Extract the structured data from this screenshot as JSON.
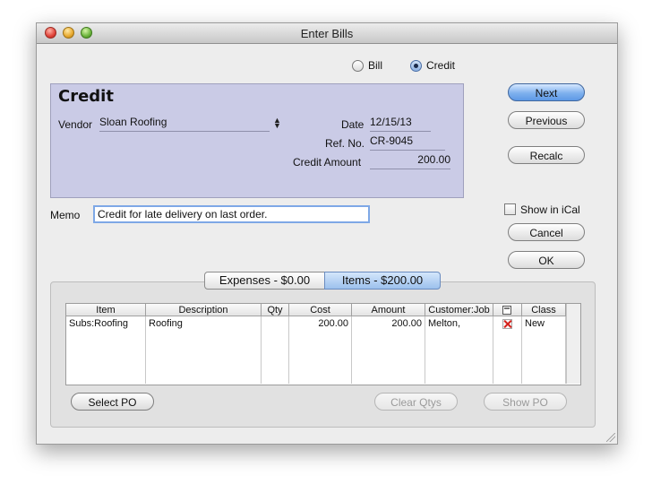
{
  "window": {
    "title": "Enter Bills"
  },
  "mode": {
    "bill_label": "Bill",
    "credit_label": "Credit",
    "selected": "credit"
  },
  "form": {
    "heading": "Credit",
    "vendor_label": "Vendor",
    "vendor_value": "Sloan Roofing",
    "date_label": "Date",
    "date_value": "12/15/13",
    "ref_label": "Ref. No.",
    "ref_value": "CR-9045",
    "amount_label": "Credit Amount",
    "amount_value": "200.00"
  },
  "memo": {
    "label": "Memo",
    "value": "Credit for late delivery on last order."
  },
  "buttons": {
    "next": "Next",
    "previous": "Previous",
    "recalc": "Recalc",
    "cancel": "Cancel",
    "ok": "OK",
    "select_po": "Select PO",
    "clear_qtys": "Clear Qtys",
    "show_po": "Show PO"
  },
  "show_in_ical": {
    "label": "Show in iCal",
    "checked": false
  },
  "tabs": [
    {
      "label": "Expenses - $0.00",
      "selected": false
    },
    {
      "label": "Items - $200.00",
      "selected": true
    }
  ],
  "table": {
    "columns": [
      "Item",
      "Description",
      "Qty",
      "Cost",
      "Amount",
      "Customer:Job",
      "",
      "Class"
    ],
    "rows": [
      {
        "item": "Subs:Roofing",
        "description": "Roofing",
        "qty": "",
        "cost": "200.00",
        "amount": "200.00",
        "customer_job": "Melton,",
        "billable": "x-mark",
        "class": "New"
      }
    ]
  },
  "colors": {
    "panel": "#cacbe6",
    "default_button": "#7fb1ee",
    "focus_ring": "#7ea8e6"
  },
  "icons": [
    "close-window-icon",
    "minimize-window-icon",
    "zoom-window-icon",
    "popup-chevron-icon",
    "billable-x-icon",
    "resize-grip-icon"
  ]
}
